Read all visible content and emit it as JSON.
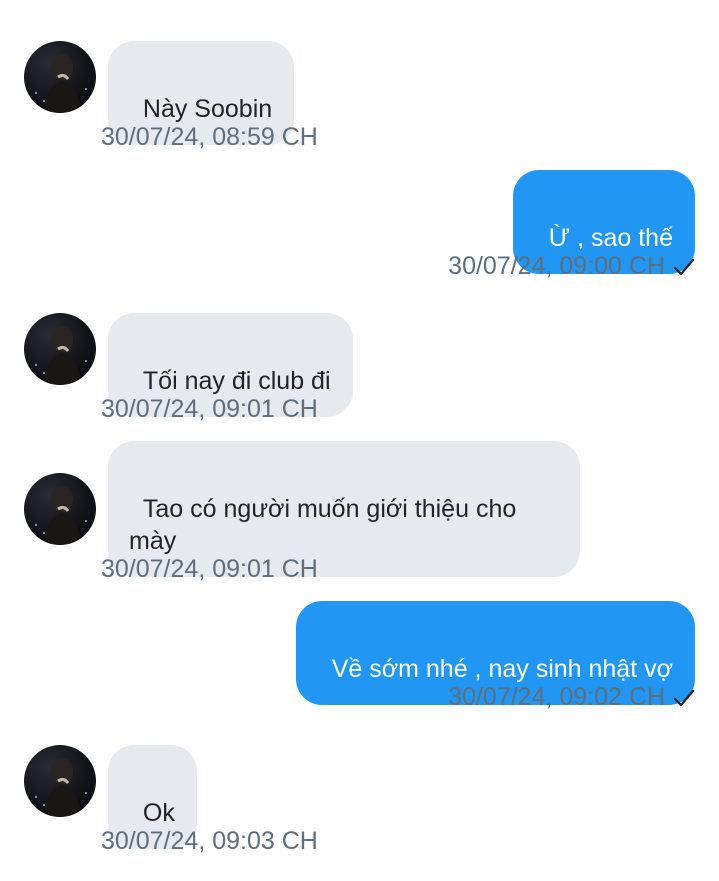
{
  "messages": [
    {
      "direction": "in",
      "text": "Này Soobin",
      "time": "30/07/24, 08:59 CH"
    },
    {
      "direction": "out",
      "text": "Ừ , sao thế",
      "time": "30/07/24, 09:00 CH",
      "status_icon": "check-icon"
    },
    {
      "direction": "in",
      "text": "Tối nay đi club đi",
      "time": "30/07/24, 09:01 CH"
    },
    {
      "direction": "in",
      "text": "Tao có người muốn giới thiệu cho\nmày",
      "time": "30/07/24, 09:01 CH"
    },
    {
      "direction": "out",
      "text": "Về sớm nhé , nay sinh nhật vợ",
      "time": "30/07/24, 09:02 CH",
      "status_icon": "check-icon"
    },
    {
      "direction": "in",
      "text": "Ok",
      "time": "30/07/24, 09:03 CH"
    }
  ],
  "colors": {
    "incoming_bubble": "#e6e9ed",
    "outgoing_bubble": "#2196f3",
    "timestamp": "#5f6e7c"
  }
}
